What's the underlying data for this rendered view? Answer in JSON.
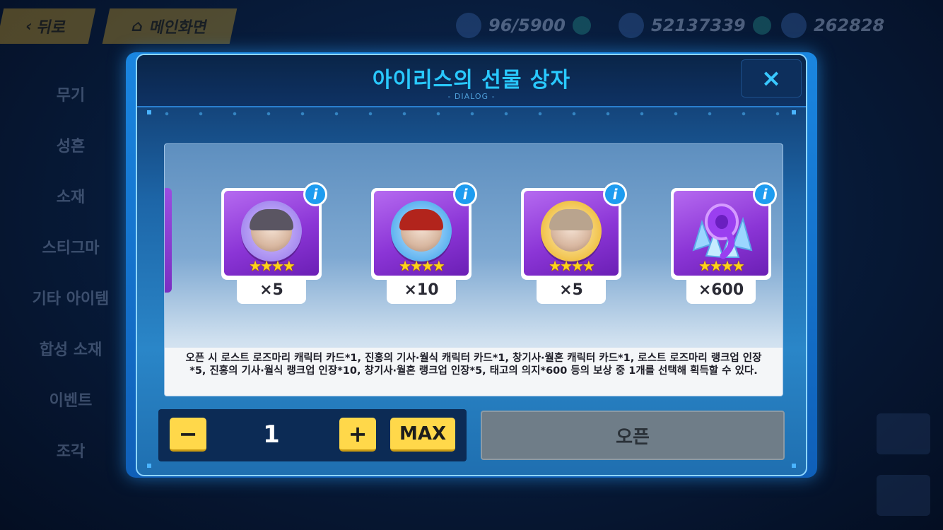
{
  "background": {
    "back_label": "뒤로",
    "home_label": "메인화면",
    "resources": [
      {
        "name": "stamina",
        "value": "96/5900"
      },
      {
        "name": "crystals",
        "value": "52137339"
      },
      {
        "name": "coins",
        "value": "262828"
      }
    ],
    "side_menu": [
      "무기",
      "성흔",
      "소재",
      "스티그마",
      "기타 아이템",
      "합성 소재",
      "이벤트",
      "조각"
    ]
  },
  "dialog": {
    "title": "아이리스의 선물 상자",
    "subtitle": "- DIALOG -",
    "close_icon": "×",
    "info_icon": "i",
    "items": [
      {
        "name": "로스트 로즈마리 랭크업 인장",
        "quantity": "×5",
        "stars": "★★★★",
        "frame_color": "#a78cf0",
        "hair_color": "#5a5562"
      },
      {
        "name": "진홍의 기사·월식 랭크업 인장",
        "quantity": "×10",
        "stars": "★★★★",
        "frame_color": "#5fb3f0",
        "hair_color": "#b2241c"
      },
      {
        "name": "창기사·월혼 랭크업 인장",
        "quantity": "×5",
        "stars": "★★★★",
        "frame_color": "#f1c24a",
        "hair_color": "#b9a48e"
      },
      {
        "name": "태고의 의지",
        "quantity": "×600",
        "stars": "★★★★",
        "frame_color": "#8a3fe0",
        "hair_color": "#9bd6ff"
      }
    ],
    "description": "오픈 시 로스트 로즈마리 캐릭터 카드*1, 진홍의 기사·월식 캐릭터 카드*1, 창기사·월혼 캐릭터 카드*1, 로스트 로즈마리 랭크업 인장*5, 진홍의 기사·월식 랭크업 인장*10, 창기사·월혼 랭크업 인장*5, 태고의 의지*600 등의 보상 중 1개를 선택해 획득할 수 있다.",
    "controls": {
      "minus_label": "−",
      "quantity": "1",
      "plus_label": "+",
      "max_label": "MAX",
      "open_label": "오픈"
    }
  }
}
